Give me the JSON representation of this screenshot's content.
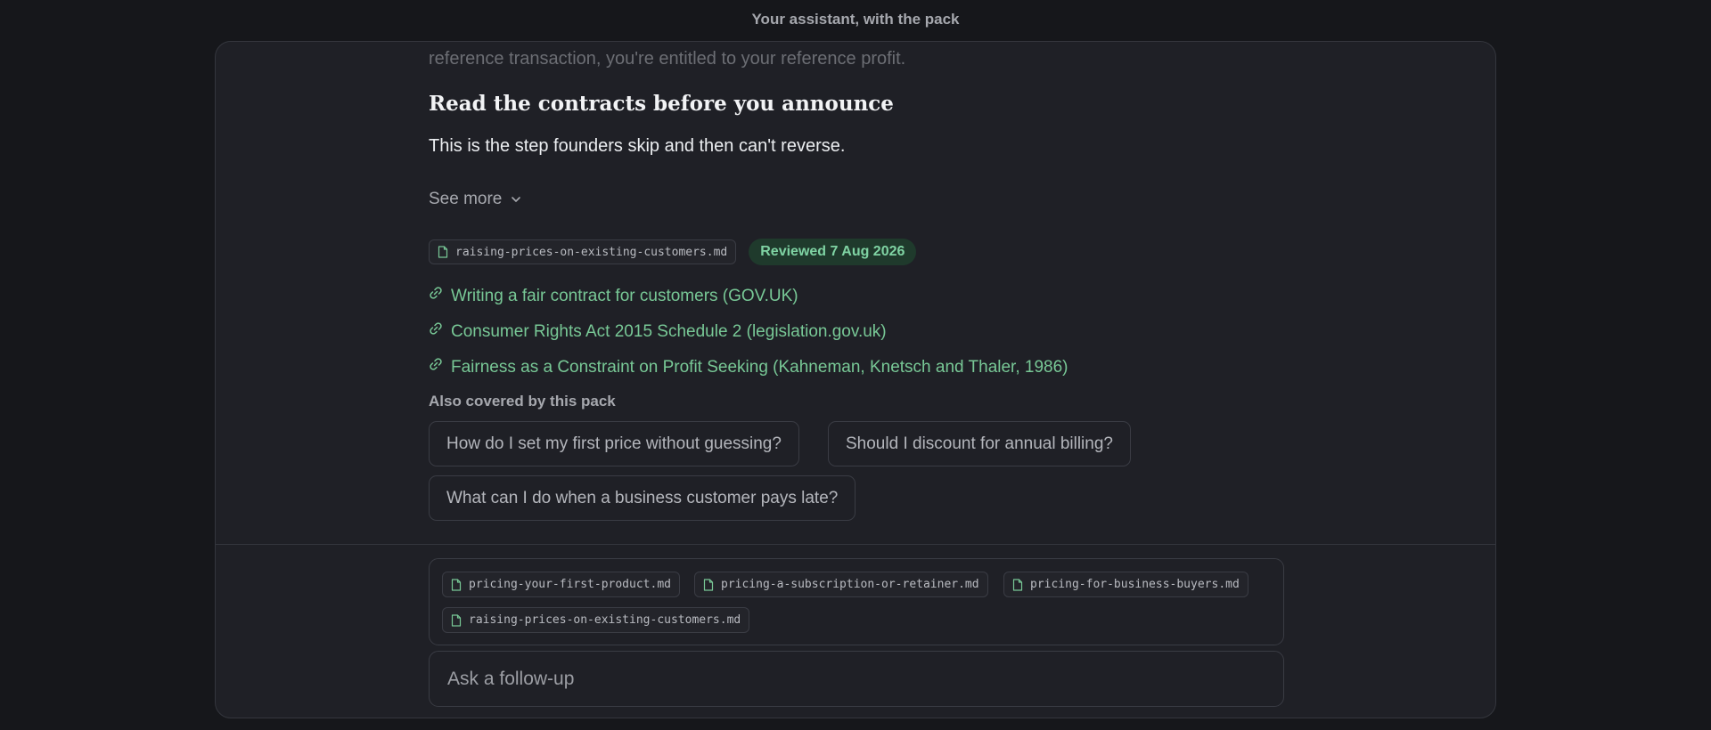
{
  "header": {
    "title": "Your assistant, with the pack"
  },
  "answer": {
    "faded_text": "reference transaction, you're entitled to your reference profit.",
    "heading": "Read the contracts before you announce",
    "body": "This is the step founders skip and then can't reverse.",
    "see_more_label": "See more",
    "source_file": "raising-prices-on-existing-customers.md",
    "reviewed_badge": "Reviewed 7 Aug 2026",
    "links": [
      {
        "label": "Writing a fair contract for customers (GOV.UK)"
      },
      {
        "label": "Consumer Rights Act 2015 Schedule 2 (legislation.gov.uk)"
      },
      {
        "label": "Fairness as a Constraint on Profit Seeking (Kahneman, Knetsch and Thaler, 1986)"
      }
    ]
  },
  "also_covered": {
    "label": "Also covered by this pack",
    "questions": [
      "How do I set my first price without guessing?",
      "Should I discount for annual billing?",
      "What can I do when a business customer pays late?"
    ]
  },
  "composer": {
    "files": [
      "pricing-your-first-product.md",
      "pricing-a-subscription-or-retainer.md",
      "pricing-for-business-buyers.md",
      "raising-prices-on-existing-customers.md"
    ],
    "placeholder": "Ask a follow-up"
  },
  "colors": {
    "accent_green": "#78c896",
    "badge_bg": "#1f3a2c",
    "background": "#16171b",
    "panel": "#1f2026"
  },
  "icons": {
    "file": "file-icon",
    "link": "link-icon",
    "chevron": "chevron-down-icon"
  }
}
